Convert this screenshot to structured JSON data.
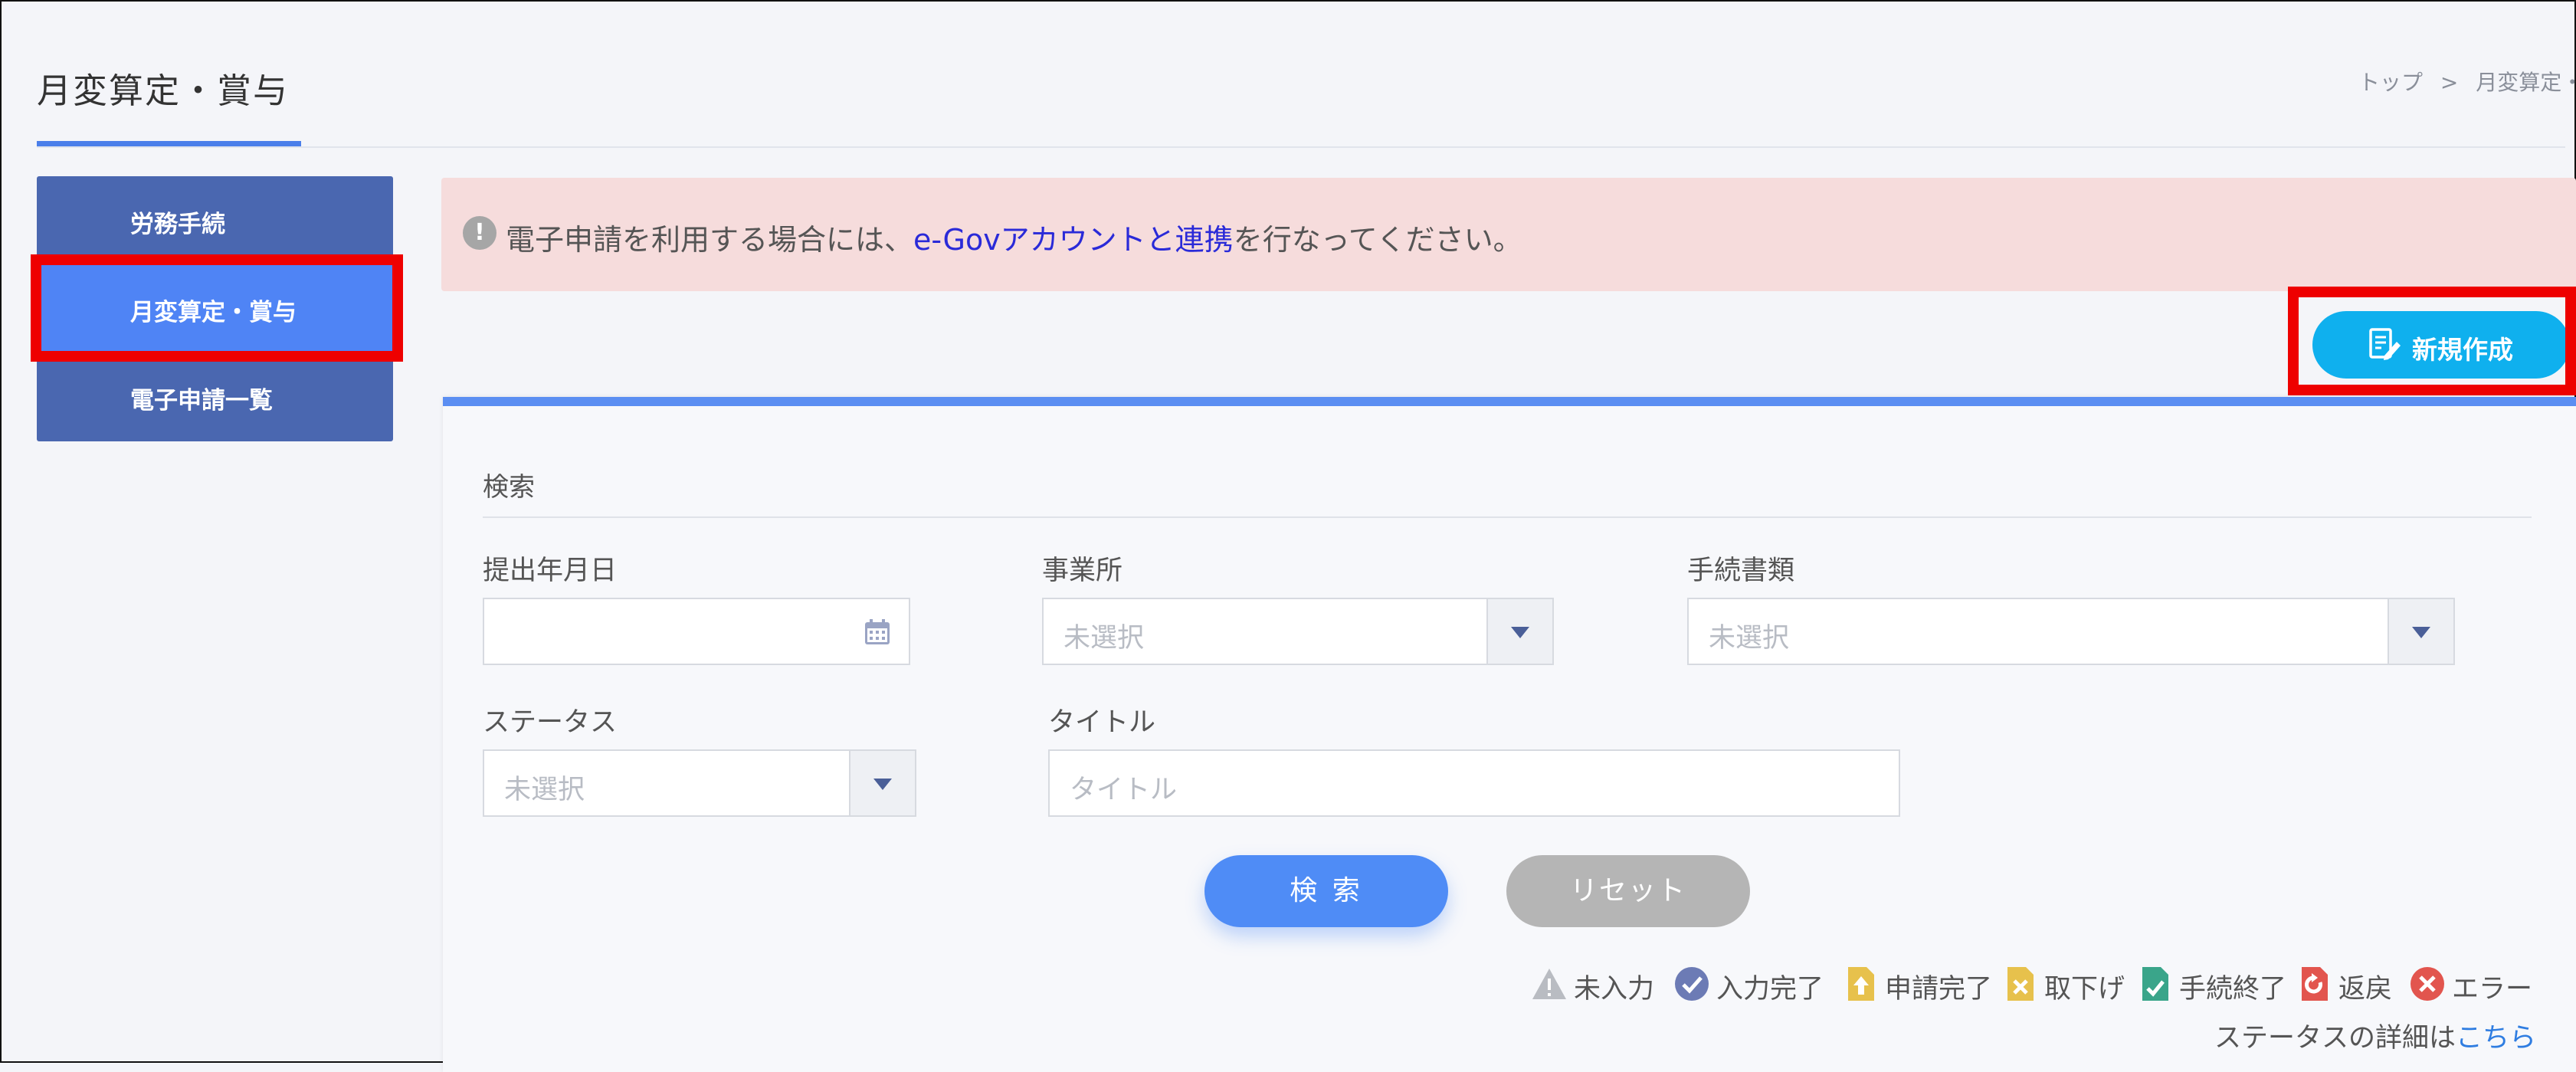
{
  "header": {
    "title": "月変算定・賞与",
    "breadcrumb": [
      "トップ",
      ">",
      "月変算定・"
    ]
  },
  "sidebar": {
    "items": [
      {
        "label": "労務手続",
        "active": false
      },
      {
        "label": "月変算定・賞与",
        "active": true
      },
      {
        "label": "電子申請一覧",
        "active": false
      }
    ]
  },
  "alert": {
    "icon": "exclamation-icon",
    "text_before": "電子申請を利用する場合には、",
    "link_text": "e-Govアカウントと連携",
    "text_after": "を行なってください。"
  },
  "new_button": {
    "label": "新規作成",
    "icon": "edit-document-icon"
  },
  "search": {
    "title": "検索",
    "fields": {
      "submit_date": {
        "label": "提出年月日",
        "value": ""
      },
      "office": {
        "label": "事業所",
        "placeholder": "未選択"
      },
      "document": {
        "label": "手続書類",
        "placeholder": "未選択"
      },
      "status": {
        "label": "ステータス",
        "placeholder": "未選択"
      },
      "title": {
        "label": "タイトル",
        "placeholder": "タイトル"
      }
    },
    "search_button": "検 索",
    "reset_button": "リセット"
  },
  "legend": [
    {
      "label": "未入力",
      "icon": "warning-icon",
      "color": "#b9bcc2"
    },
    {
      "label": "入力完了",
      "icon": "check-circle-icon",
      "color": "#6c7bb5"
    },
    {
      "label": "申請完了",
      "icon": "upload-document-icon",
      "color": "#e7c14c"
    },
    {
      "label": "取下げ",
      "icon": "cancel-document-icon",
      "color": "#e7c14c"
    },
    {
      "label": "手続終了",
      "icon": "finished-document-icon",
      "color": "#3aa58a"
    },
    {
      "label": "返戻",
      "icon": "return-document-icon",
      "color": "#e2554e"
    },
    {
      "label": "エラー",
      "icon": "error-circle-icon",
      "color": "#e2554e"
    }
  ],
  "status_note": {
    "text": "ステータスの詳細は",
    "link": "こちら"
  },
  "colors": {
    "accent": "#4f84f5",
    "sidebar": "#4a67b0",
    "alert_bg": "#f6dcdc",
    "new_button": "#0fb0ee",
    "highlight": "#ee0000"
  }
}
